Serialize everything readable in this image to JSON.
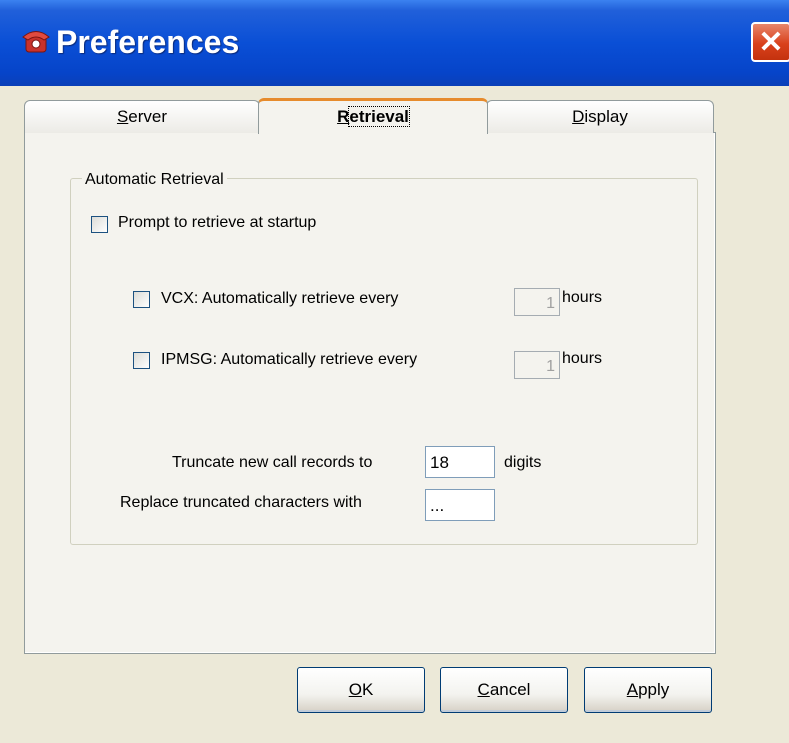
{
  "window": {
    "title": "Preferences",
    "close_glyph": "✕"
  },
  "tabs": [
    {
      "label_first": "S",
      "label_rest": "erver",
      "active": false
    },
    {
      "label_first": "R",
      "label_rest": "etrieval",
      "active": true
    },
    {
      "label_first": "D",
      "label_rest": "isplay",
      "active": false
    }
  ],
  "retrieval": {
    "group_title": "Automatic Retrieval",
    "prompt_label": "Prompt to retrieve at startup",
    "prompt_checked": false,
    "vcx": {
      "label": "VCX: Automatically retrieve every",
      "checked": false,
      "value": "1",
      "unit": "hours"
    },
    "ipmsg": {
      "label": "IPMSG: Automatically retrieve every",
      "checked": false,
      "value": "1",
      "unit": "hours"
    },
    "truncate_label": "Truncate new call records to",
    "truncate_value": "18",
    "truncate_unit": "digits",
    "replace_label": "Replace truncated characters with",
    "replace_value": "..."
  },
  "buttons": {
    "ok": {
      "first": "O",
      "rest": "K"
    },
    "cancel": {
      "first": "C",
      "rest": "ancel"
    },
    "apply": {
      "first": "A",
      "rest": "pply"
    }
  },
  "colors": {
    "titlebar": "#0A4FD6",
    "close": "#D9411C",
    "tab_active_accent": "#E68B2C",
    "dialog_bg": "#ECE9D8"
  },
  "icons": {
    "title": "telephone-icon",
    "close": "close-icon"
  }
}
